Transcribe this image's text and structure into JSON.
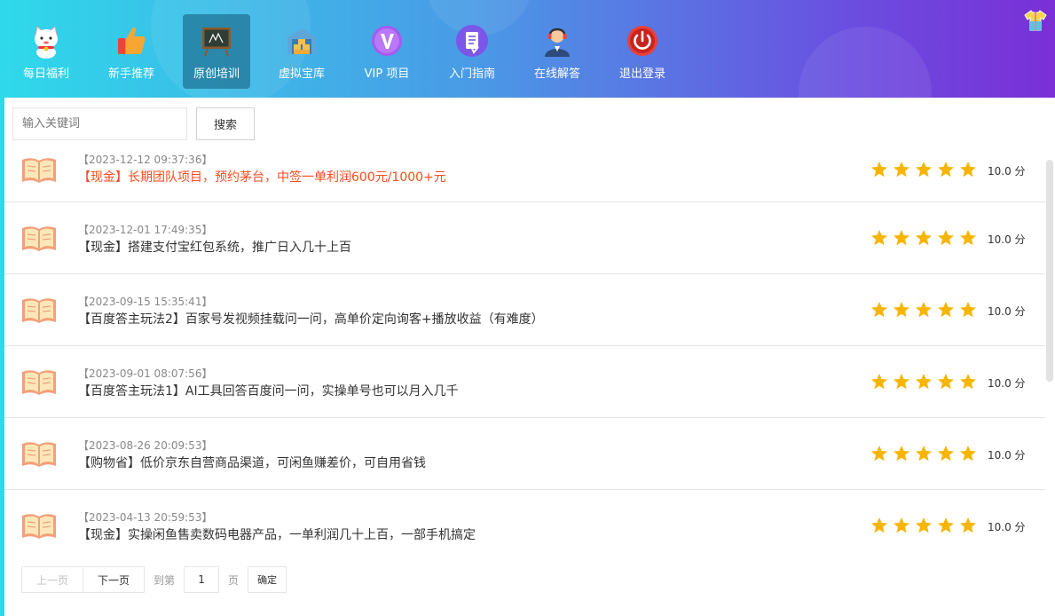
{
  "nav": {
    "items": [
      {
        "label": "每日福利",
        "icon": "lucky-cat-icon"
      },
      {
        "label": "新手推荐",
        "icon": "thumbs-up-icon"
      },
      {
        "label": "原创培训",
        "icon": "blackboard-icon",
        "active": true
      },
      {
        "label": "虚拟宝库",
        "icon": "warehouse-icon"
      },
      {
        "label": "VIP 项目",
        "icon": "vip-icon"
      },
      {
        "label": "入门指南",
        "icon": "document-icon"
      },
      {
        "label": "在线解答",
        "icon": "support-agent-icon"
      },
      {
        "label": "退出登录",
        "icon": "power-icon"
      }
    ]
  },
  "search": {
    "placeholder": "输入关键词",
    "button_label": "搜索"
  },
  "list": {
    "items": [
      {
        "date": "【2023-12-12 09:37:36】",
        "title": "【现金】长期团队项目，预约茅台，中签一单利润600元/1000+元",
        "stars": 5,
        "score": "10.0 分",
        "highlight": true
      },
      {
        "date": "【2023-12-01 17:49:35】",
        "title": "【现金】搭建支付宝红包系统，推广日入几十上百",
        "stars": 5,
        "score": "10.0 分"
      },
      {
        "date": "【2023-09-15 15:35:41】",
        "title": "【百度答主玩法2】百家号发视频挂载问一问，高单价定向询客+播放收益（有难度）",
        "stars": 5,
        "score": "10.0 分"
      },
      {
        "date": "【2023-09-01 08:07:56】",
        "title": "【百度答主玩法1】AI工具回答百度问一问，实操单号也可以月入几千",
        "stars": 5,
        "score": "10.0 分"
      },
      {
        "date": "【2023-08-26 20:09:53】",
        "title": "【购物省】低价京东自营商品渠道，可闲鱼赚差价，可自用省钱",
        "stars": 5,
        "score": "10.0 分"
      },
      {
        "date": "【2023-04-13 20:59:53】",
        "title": "【现金】实操闲鱼售卖数码电器产品，一单利润几十上百，一部手机搞定",
        "stars": 5,
        "score": "10.0 分"
      }
    ]
  },
  "pager": {
    "prev_label": "上一页",
    "next_label": "下一页",
    "goto_label": "到第",
    "page_value": "1",
    "page_unit": "页",
    "confirm_label": "确定"
  },
  "colors": {
    "accent_star": "#f7b500",
    "highlight_title": "#ff4a1d"
  }
}
